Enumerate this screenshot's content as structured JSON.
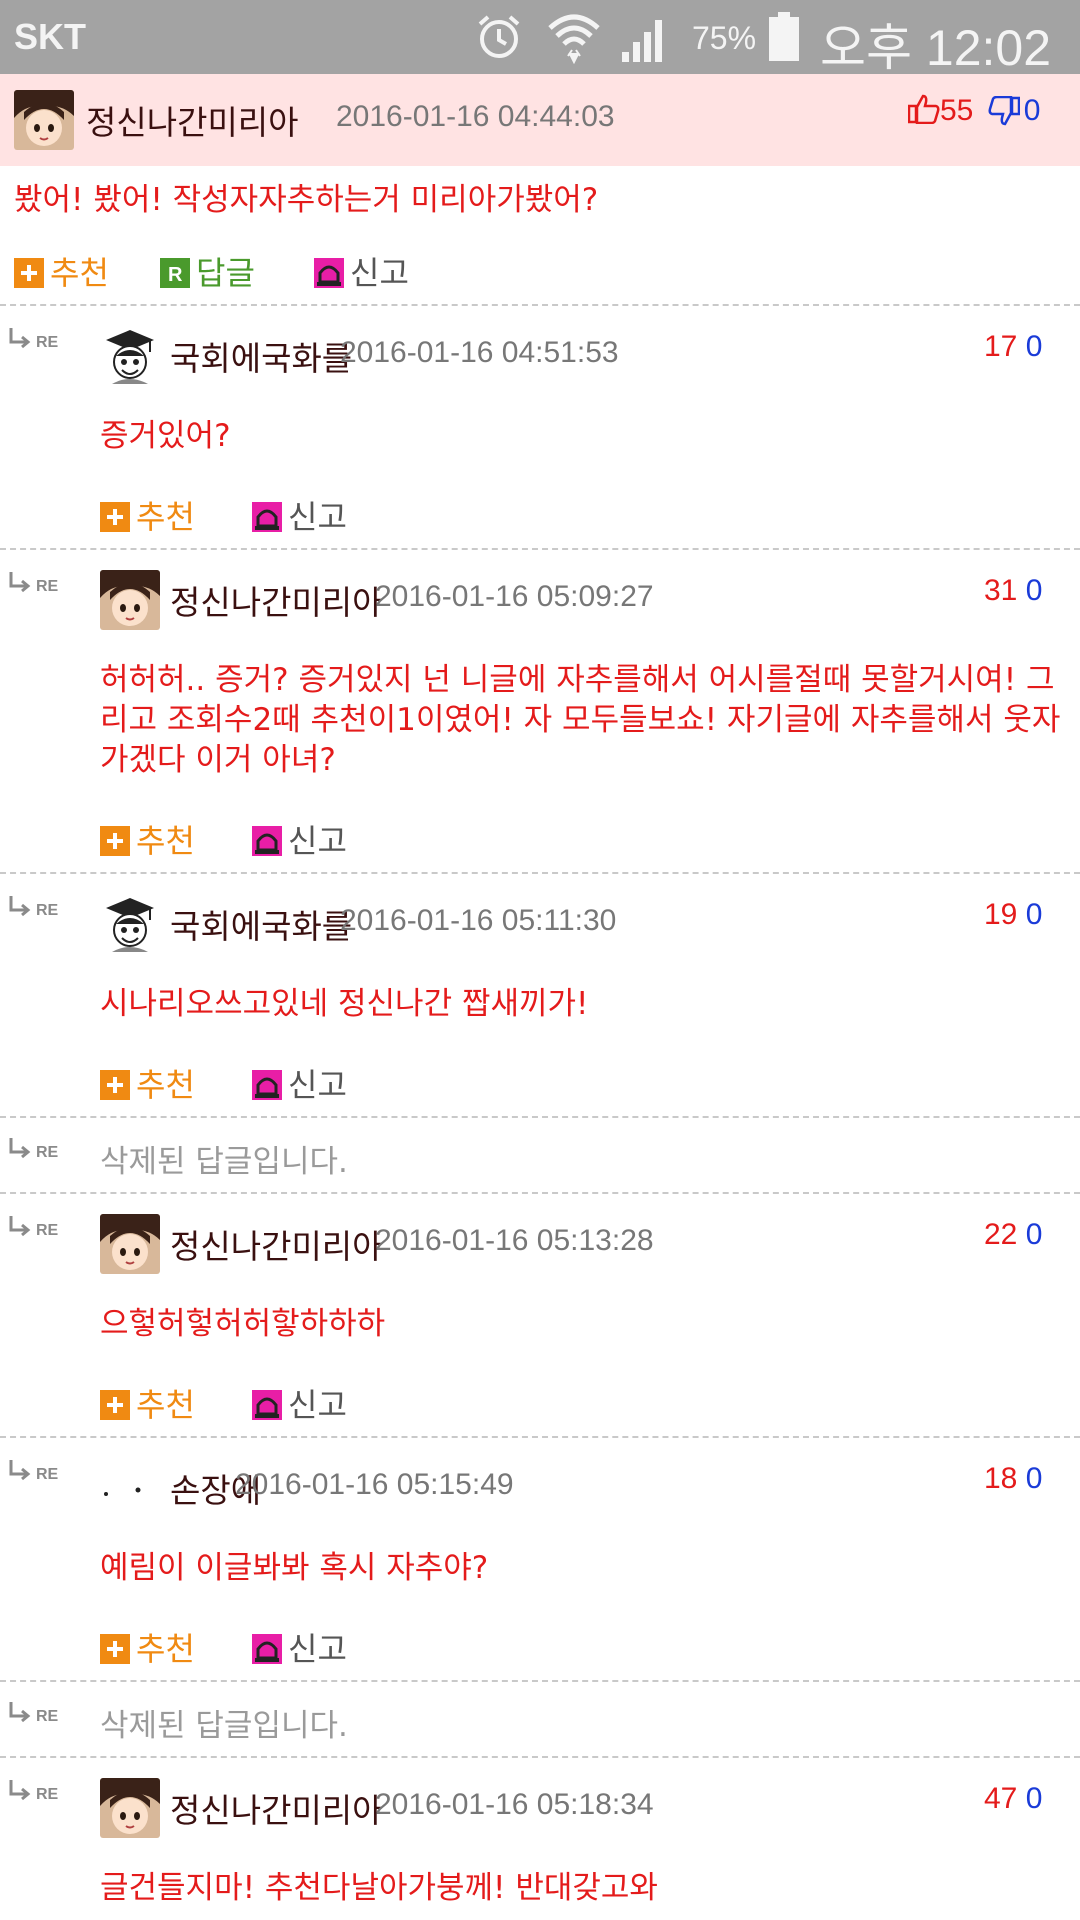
{
  "status_bar": {
    "carrier": "SKT",
    "battery": "75%",
    "time": "오후 12:02"
  },
  "main_post": {
    "author": "정신나간미리아",
    "date": "2016-01-16 04:44:03",
    "up_votes": "55",
    "down_votes": "0",
    "text": "봤어! 봤어! 작성자자추하는거 미리아가봤어?",
    "actions": {
      "recommend": "추천",
      "reply": "답글",
      "report": "신고"
    }
  },
  "replies": [
    {
      "type": "comment",
      "author": "국회에국화를",
      "avatar": "graduate",
      "date": "2016-01-16 04:51:53",
      "up": "17",
      "down": "0",
      "text": "증거있어?"
    },
    {
      "type": "comment",
      "author": "정신나간미리아",
      "avatar": "anime",
      "date": "2016-01-16 05:09:27",
      "up": "31",
      "down": "0",
      "text": "허허허.. 증거? 증거있지 넌 니글에 자추를해서 어시를절때 못할거시여! 그리고 조회수2때 추천이1이였어! 자 모두들보쇼! 자기글에 자추를해서 웃자가겠다 이거 아녀?"
    },
    {
      "type": "comment",
      "author": "국회에국화를",
      "avatar": "graduate",
      "date": "2016-01-16 05:11:30",
      "up": "19",
      "down": "0",
      "text": "시나리오쓰고있네 정신나간 짭새끼가!"
    },
    {
      "type": "deleted",
      "text": "삭제된 답글입니다."
    },
    {
      "type": "comment",
      "author": "정신나간미리아",
      "avatar": "anime",
      "date": "2016-01-16 05:13:28",
      "up": "22",
      "down": "0",
      "text": "으헣허헣허허핳하하하"
    },
    {
      "type": "comment",
      "author": "손장애",
      "avatar": "dots",
      "date": "2016-01-16 05:15:49",
      "up": "18",
      "down": "0",
      "text": "예림이 이글봐봐 혹시 자추야?"
    },
    {
      "type": "deleted",
      "text": "삭제된 답글입니다."
    },
    {
      "type": "comment",
      "author": "정신나간미리아",
      "avatar": "anime",
      "date": "2016-01-16 05:18:34",
      "up": "47",
      "down": "0",
      "text": "글건들지마! 추천다날아가붕께! 반대갖고와"
    }
  ],
  "reply_actions": {
    "recommend": "추천",
    "report": "신고"
  },
  "re_label": "RE",
  "colors": {
    "accent_red": "#e41b1b",
    "down_blue": "#1a3bd8",
    "recommend_orange": "#f08a12",
    "reply_green": "#4a9a2c",
    "header_bg": "#ffe3e3"
  }
}
